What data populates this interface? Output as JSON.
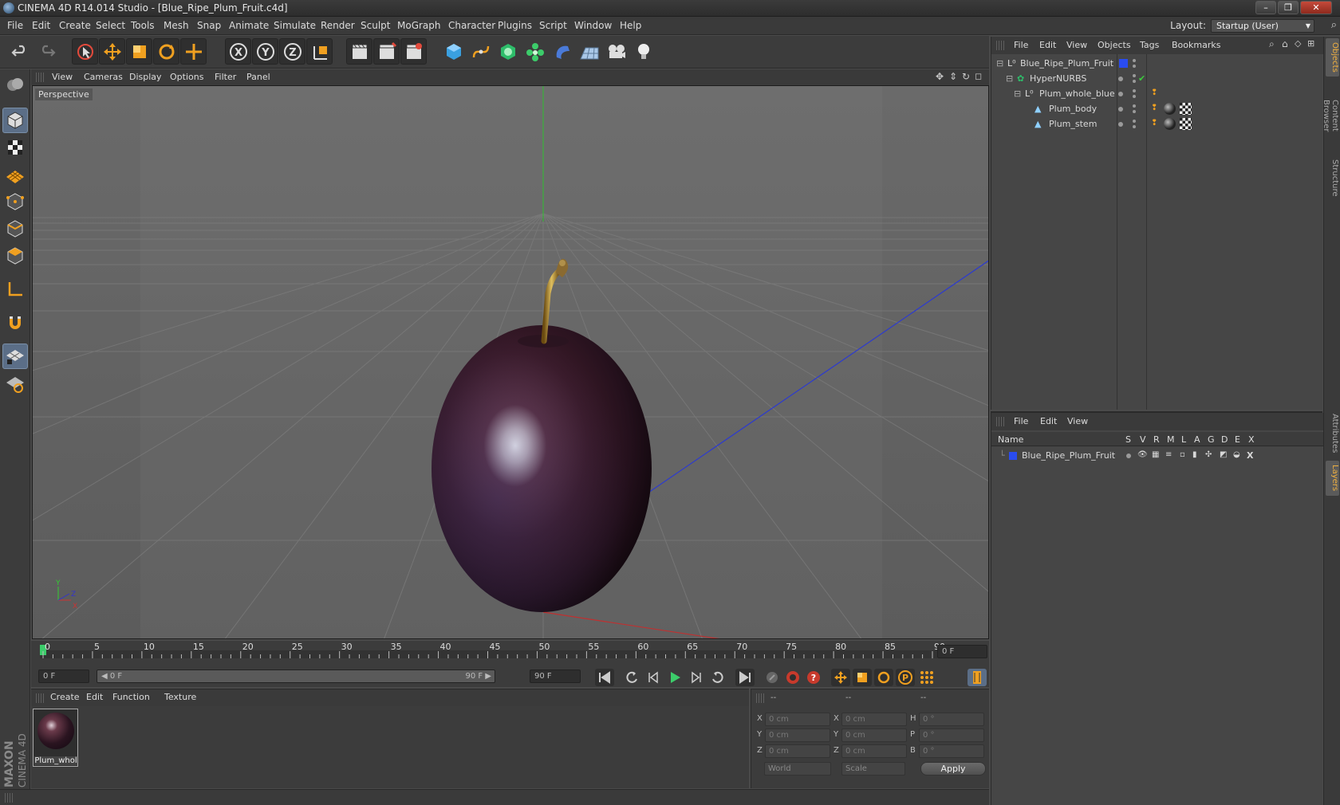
{
  "window": {
    "title": "CINEMA 4D R14.014 Studio - [Blue_Ripe_Plum_Fruit.c4d]",
    "buttons": [
      "–",
      "❐",
      "✕"
    ]
  },
  "menu": [
    "File",
    "Edit",
    "Create",
    "Select",
    "Tools",
    "Mesh",
    "Snap",
    "Animate",
    "Simulate",
    "Render",
    "Sculpt",
    "MoGraph",
    "Character",
    "Plugins",
    "Script",
    "Window",
    "Help"
  ],
  "layout": {
    "label": "Layout:",
    "value": "Startup (User)"
  },
  "viewport": {
    "menu": [
      "View",
      "Cameras",
      "Display",
      "Options",
      "Filter",
      "Panel"
    ],
    "label": "Perspective",
    "axes": {
      "y": "Y",
      "x": "X",
      "z": "Z"
    }
  },
  "timeline": {
    "ticks": [
      "0",
      "5",
      "10",
      "15",
      "20",
      "25",
      "30",
      "35",
      "40",
      "45",
      "50",
      "55",
      "60",
      "65",
      "70",
      "75",
      "80",
      "85",
      "90"
    ],
    "current_frame": "0 F",
    "start_field": "0 F",
    "range_start": "◀ 0 F",
    "range_end": "90 F ▶",
    "end_field": "90 F"
  },
  "materials": {
    "menu": [
      "Create",
      "Edit",
      "Function",
      "Texture"
    ],
    "items": [
      {
        "name": "Plum_whol"
      }
    ]
  },
  "coords": {
    "headers": [
      "--",
      "--",
      "--"
    ],
    "rows": [
      {
        "a": "X",
        "av": "0 cm",
        "b": "X",
        "bv": "0 cm",
        "c": "H",
        "cv": "0 °"
      },
      {
        "a": "Y",
        "av": "0 cm",
        "b": "Y",
        "bv": "0 cm",
        "c": "P",
        "cv": "0 °"
      },
      {
        "a": "Z",
        "av": "0 cm",
        "b": "Z",
        "bv": "0 cm",
        "c": "B",
        "cv": "0 °"
      }
    ],
    "world": "World",
    "scale": "Scale",
    "apply": "Apply"
  },
  "objects": {
    "menu": [
      "File",
      "Edit",
      "View",
      "Objects",
      "Tags",
      "Bookmarks"
    ],
    "tree": [
      {
        "name": "Blue_Ripe_Plum_Fruit",
        "depth": 0
      },
      {
        "name": "HyperNURBS",
        "depth": 1
      },
      {
        "name": "Plum_whole_blue",
        "depth": 2
      },
      {
        "name": "Plum_body",
        "depth": 3
      },
      {
        "name": "Plum_stem",
        "depth": 3
      }
    ]
  },
  "layers": {
    "menu": [
      "File",
      "Edit",
      "View"
    ],
    "columns": [
      "Name",
      "S",
      "V",
      "R",
      "M",
      "L",
      "A",
      "G",
      "D",
      "E",
      "X"
    ],
    "rows": [
      {
        "name": "Blue_Ripe_Plum_Fruit"
      }
    ]
  },
  "sidetabs": [
    "Objects",
    "Content Browser",
    "Structure",
    "Attributes",
    "Layers"
  ],
  "brand": {
    "line1": "MAXON",
    "line2": "CINEMA 4D"
  },
  "colors": {
    "accent": "#f0a020",
    "layer_blue": "#2a4cf0",
    "active_tool": "#5b6e87"
  }
}
